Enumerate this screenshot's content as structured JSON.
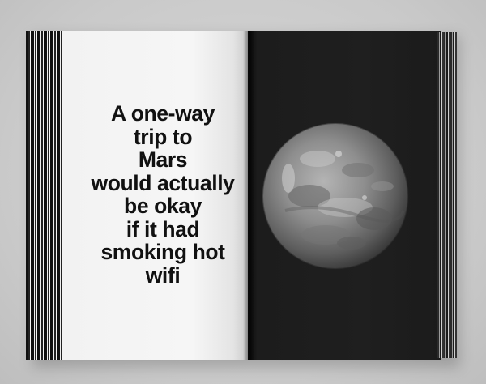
{
  "quote": {
    "lines": [
      "A one-way",
      "trip to",
      "Mars",
      "would actually",
      "be okay",
      "if it had",
      "smoking hot",
      "wifi"
    ]
  },
  "planet": {
    "name_icon": "mars-planet-icon"
  },
  "colors": {
    "page_light": "#f4f4f4",
    "page_dark": "#1e1e1e",
    "text": "#111111",
    "background": "#cfcfcf"
  }
}
